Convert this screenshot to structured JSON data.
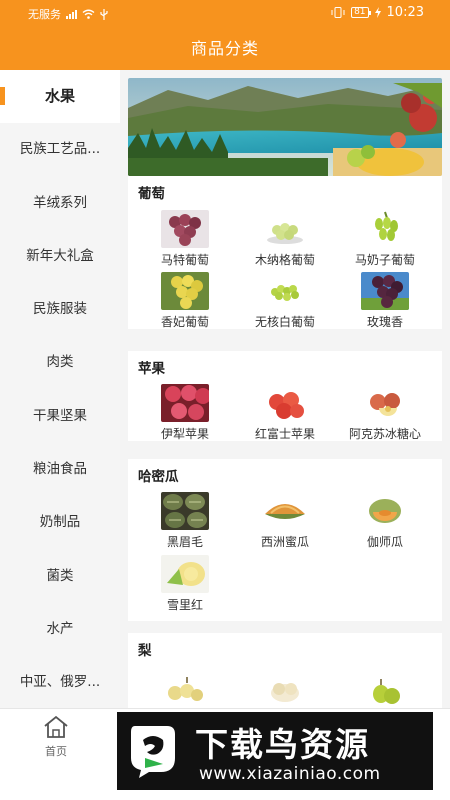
{
  "status_bar": {
    "carrier": "无服务",
    "battery": "81",
    "time": "10:23"
  },
  "header": {
    "title": "商品分类"
  },
  "sidebar": {
    "items": [
      {
        "label": "水果",
        "active": true
      },
      {
        "label": "民族工艺品..."
      },
      {
        "label": "羊绒系列"
      },
      {
        "label": "新年大礼盒"
      },
      {
        "label": "民族服装"
      },
      {
        "label": "肉类"
      },
      {
        "label": "干果坚果"
      },
      {
        "label": "粮油食品"
      },
      {
        "label": "奶制品"
      },
      {
        "label": "菌类"
      },
      {
        "label": "水产"
      },
      {
        "label": "中亚、俄罗..."
      }
    ]
  },
  "sections": [
    {
      "title": "葡萄",
      "products": [
        "马特葡萄",
        "木纳格葡萄",
        "马奶子葡萄",
        "香妃葡萄",
        "无核白葡萄",
        "玫瑰香"
      ]
    },
    {
      "title": "苹果",
      "products": [
        "伊犁苹果",
        "红富士苹果",
        "阿克苏冰糖心"
      ]
    },
    {
      "title": "哈密瓜",
      "products": [
        "黑眉毛",
        "西洲蜜瓜",
        "伽师瓜",
        "雪里红"
      ]
    },
    {
      "title": "梨",
      "products": []
    }
  ],
  "bottom_nav": {
    "home_label": "首页"
  },
  "watermark": {
    "title": "下载鸟资源",
    "url": "www.xiazainiao.com"
  },
  "colors": {
    "accent": "#f7931e"
  }
}
